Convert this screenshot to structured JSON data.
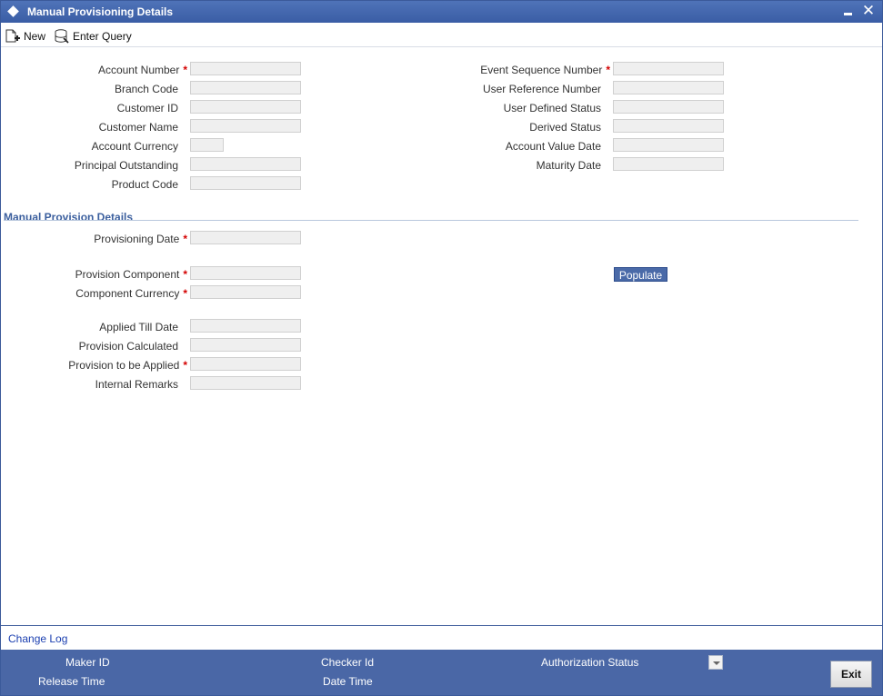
{
  "window": {
    "title": "Manual Provisioning Details"
  },
  "toolbar": {
    "new_label": "New",
    "enter_query_label": "Enter Query"
  },
  "left_fields": [
    {
      "label": "Account Number",
      "required": true,
      "value": ""
    },
    {
      "label": "Branch Code",
      "required": false,
      "value": ""
    },
    {
      "label": "Customer ID",
      "required": false,
      "value": ""
    },
    {
      "label": "Customer Name",
      "required": false,
      "value": ""
    },
    {
      "label": "Account Currency",
      "required": false,
      "value": ""
    },
    {
      "label": "Principal Outstanding",
      "required": false,
      "value": ""
    },
    {
      "label": "Product Code",
      "required": false,
      "value": ""
    }
  ],
  "right_fields": [
    {
      "label": "Event Sequence Number",
      "required": true,
      "value": ""
    },
    {
      "label": "User Reference Number",
      "required": false,
      "value": ""
    },
    {
      "label": "User Defined Status",
      "required": false,
      "value": ""
    },
    {
      "label": "Derived Status",
      "required": false,
      "value": ""
    },
    {
      "label": "Account Value Date",
      "required": false,
      "value": ""
    },
    {
      "label": "Maturity Date",
      "required": false,
      "value": ""
    }
  ],
  "section": {
    "title": "Manual Provision Details",
    "provisioning_date": {
      "label": "Provisioning Date",
      "required": true,
      "value": ""
    },
    "provision_component": {
      "label": "Provision Component",
      "required": true,
      "value": ""
    },
    "component_currency": {
      "label": "Component Currency",
      "required": true,
      "value": ""
    },
    "applied_till_date": {
      "label": "Applied Till Date",
      "required": false,
      "value": ""
    },
    "provision_calculated": {
      "label": "Provision Calculated",
      "required": false,
      "value": ""
    },
    "provision_to_be_applied": {
      "label": "Provision to be Applied",
      "required": true,
      "value": ""
    },
    "internal_remarks": {
      "label": "Internal Remarks",
      "required": false,
      "value": ""
    },
    "populate_label": "Populate"
  },
  "required_marker": "*",
  "change_log": "Change Log",
  "footer": {
    "maker_id": "Maker ID",
    "release_time": "Release Time",
    "checker_id": "Checker Id",
    "date_time": "Date Time",
    "authorization_status": "Authorization Status",
    "exit_label": "Exit"
  }
}
